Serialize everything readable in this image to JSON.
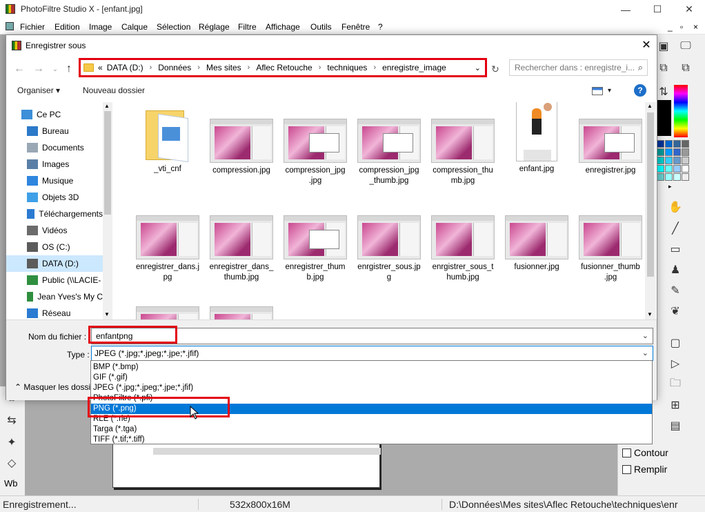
{
  "app": {
    "title": "PhotoFiltre Studio X - [enfant.jpg]",
    "window_controls": [
      "—",
      "☐",
      "✕"
    ],
    "menu": [
      "Fichier",
      "Edition",
      "Image",
      "Calque",
      "Sélection",
      "Réglage",
      "Filtre",
      "Affichage",
      "Outils",
      "Fenêtre",
      "?"
    ],
    "mdi_controls": [
      "_",
      "▫",
      "×"
    ],
    "status": {
      "message": "Enregistrement...",
      "image_info": "532x800x16M",
      "path": "D:\\Données\\Mes sites\\Aflec Retouche\\techniques\\enr"
    },
    "options": {
      "contour": "Contour",
      "remplir": "Remplir"
    },
    "left_tool_label": "Wb"
  },
  "dialog": {
    "title": "Enregistrer sous",
    "close": "✕",
    "breadcrumb": [
      "«",
      "DATA (D:)",
      "Données",
      "Mes sites",
      "Aflec Retouche",
      "techniques",
      "enregistre_image"
    ],
    "search_placeholder": "Rechercher dans : enregistre_i...",
    "organize": "Organiser",
    "new_folder": "Nouveau dossier",
    "help": "?",
    "nav_items": [
      {
        "label": "Ce PC",
        "icon": "computer-icon"
      },
      {
        "label": "Bureau",
        "icon": "desktop-icon"
      },
      {
        "label": "Documents",
        "icon": "documents-icon"
      },
      {
        "label": "Images",
        "icon": "pictures-icon"
      },
      {
        "label": "Musique",
        "icon": "music-icon"
      },
      {
        "label": "Objets 3D",
        "icon": "objects3d-icon"
      },
      {
        "label": "Téléchargements",
        "icon": "downloads-icon"
      },
      {
        "label": "Vidéos",
        "icon": "videos-icon"
      },
      {
        "label": "OS (C:)",
        "icon": "drive-icon"
      },
      {
        "label": "DATA (D:)",
        "icon": "drive-icon"
      },
      {
        "label": "Public (\\\\LACIE-",
        "icon": "network-drive-icon"
      },
      {
        "label": "Jean Yves's My C",
        "icon": "network-drive-icon"
      },
      {
        "label": "Réseau",
        "icon": "network-icon"
      }
    ],
    "files": [
      {
        "name": "_vti_cnf",
        "kind": "folder"
      },
      {
        "name": "compression.jpg",
        "kind": "shot"
      },
      {
        "name": "compression_jpg\n.jpg",
        "kind": "win"
      },
      {
        "name": "compression_jpg\n_thumb.jpg",
        "kind": "win"
      },
      {
        "name": "compression_thu\nmb.jpg",
        "kind": "shot"
      },
      {
        "name": "enfant.jpg",
        "kind": "kid"
      },
      {
        "name": "enregistrer.jpg",
        "kind": "win"
      },
      {
        "name": "enregistrer_dans.j\npg",
        "kind": "shot"
      },
      {
        "name": "enregistrer_dans_\nthumb.jpg",
        "kind": "shot"
      },
      {
        "name": "enregistrer_thum\nb.jpg",
        "kind": "win"
      },
      {
        "name": "enrgistrer_sous.jp\ng",
        "kind": "shot"
      },
      {
        "name": "enrgistrer_sous_t\nhumb.jpg",
        "kind": "shot"
      },
      {
        "name": "fusionner.jpg",
        "kind": "shot"
      },
      {
        "name": "fusionner_thumb\n.jpg",
        "kind": "shot"
      }
    ],
    "filename_label": "Nom du fichier :",
    "filename_value": "enfantpng",
    "type_label": "Type :",
    "type_value": "JPEG (*.jpg;*.jpeg;*.jpe;*.jfif)",
    "hide_folders": "Masquer les dossi",
    "type_options": [
      "BMP (*.bmp)",
      "GIF (*.gif)",
      "JPEG (*.jpg;*.jpeg;*.jpe;*.jfif)",
      "PhotoFiltre (*.pfi)",
      "PNG (*.png)",
      "RLE (*.rle)",
      "Targa (*.tga)",
      "TIFF (*.tif;*.tiff)"
    ],
    "selected_option": "PNG (*.png)"
  },
  "colors": {
    "highlight_red": "#e3000f",
    "selection_blue": "#0078d7"
  }
}
